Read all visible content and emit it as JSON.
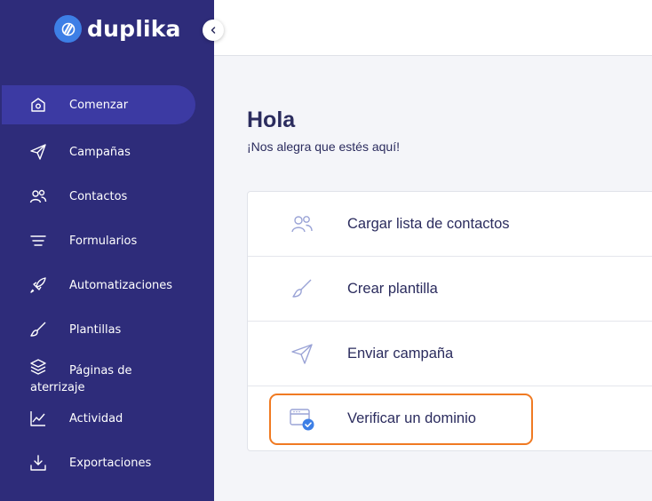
{
  "brand": {
    "name": "duplika",
    "accent": "#3d7fe6",
    "sidebar_bg": "#2e2c7a"
  },
  "sidebar": {
    "items": [
      {
        "label": "Comenzar",
        "icon": "home-icon",
        "active": true
      },
      {
        "label": "Campañas",
        "icon": "paper-plane-icon"
      },
      {
        "label": "Contactos",
        "icon": "users-icon"
      },
      {
        "label": "Formularios",
        "icon": "lines-icon"
      },
      {
        "label": "Automatizaciones",
        "icon": "rocket-icon"
      },
      {
        "label": "Plantillas",
        "icon": "brush-icon"
      },
      {
        "label": "Páginas de aterrizaje",
        "icon": "layers-icon"
      },
      {
        "label": "Actividad",
        "icon": "chart-icon"
      },
      {
        "label": "Exportaciones",
        "icon": "download-icon"
      }
    ]
  },
  "main": {
    "title": "Hola",
    "subtitle": "¡Nos alegra que estés aquí!",
    "tasks": [
      {
        "label": "Cargar lista de contactos",
        "icon": "users-icon"
      },
      {
        "label": "Crear plantilla",
        "icon": "brush-icon"
      },
      {
        "label": "Enviar campaña",
        "icon": "paper-plane-icon"
      },
      {
        "label": "Verificar un dominio",
        "icon": "browser-check-icon",
        "highlighted": true
      }
    ]
  },
  "highlight_color": "#f07a22"
}
